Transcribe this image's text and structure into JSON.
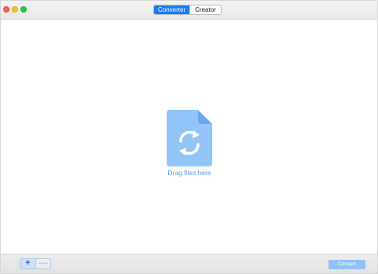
{
  "window": {
    "tabs": [
      {
        "label": "Converter",
        "active": true
      },
      {
        "label": "Creator",
        "active": false
      }
    ]
  },
  "dropzone": {
    "icon": "file-convert-icon",
    "label": "Drag files here",
    "accent_color": "#8ec2f7"
  },
  "toolbar": {
    "add_label": "+",
    "remove_label": "—",
    "convert_label": "Convert"
  },
  "colors": {
    "active_tab": "#1a7cf5",
    "convert_button": "#90c1f7",
    "label_blue": "#5a9bea"
  }
}
